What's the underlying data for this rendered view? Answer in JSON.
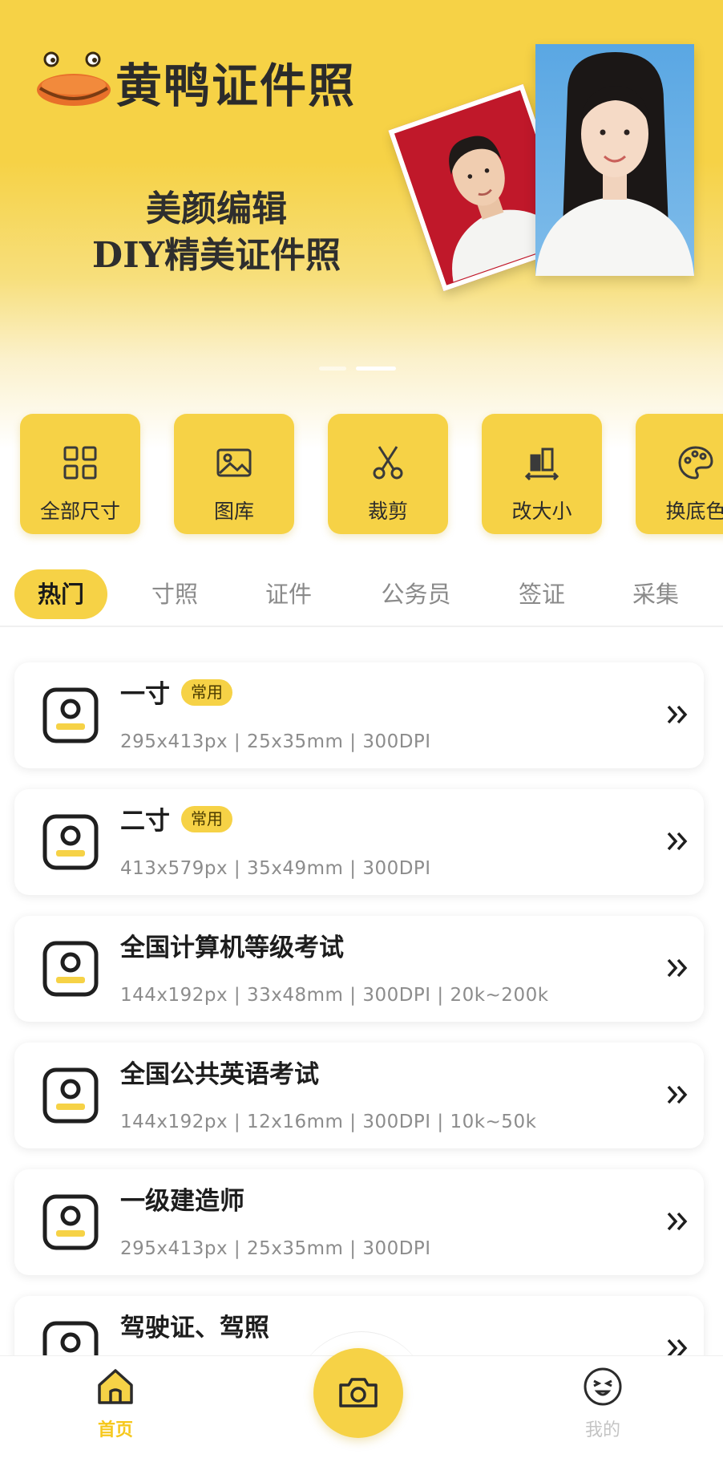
{
  "banner": {
    "app_name": "黄鸭证件照",
    "slogan_line1": "美颜编辑",
    "slogan_line2": "DIY精美证件照",
    "pagination": {
      "count": 2,
      "active_index": 1
    }
  },
  "tools": [
    {
      "label": "全部尺寸",
      "icon": "grid-icon"
    },
    {
      "label": "图库",
      "icon": "image-icon"
    },
    {
      "label": "裁剪",
      "icon": "scissors-icon"
    },
    {
      "label": "改大小",
      "icon": "resize-icon"
    },
    {
      "label": "换底色",
      "icon": "palette-icon"
    }
  ],
  "tabs": [
    {
      "label": "热门",
      "active": true
    },
    {
      "label": "寸照",
      "active": false
    },
    {
      "label": "证件",
      "active": false
    },
    {
      "label": "公务员",
      "active": false
    },
    {
      "label": "签证",
      "active": false
    },
    {
      "label": "采集",
      "active": false
    }
  ],
  "specs": [
    {
      "title": "一寸",
      "badge": "常用",
      "spec": "295x413px  |  25x35mm  |  300DPI"
    },
    {
      "title": "二寸",
      "badge": "常用",
      "spec": "413x579px  |  35x49mm  |  300DPI"
    },
    {
      "title": "全国计算机等级考试",
      "badge": "",
      "spec": "144x192px  |  33x48mm  |  300DPI  |  20k~200k"
    },
    {
      "title": "全国公共英语考试",
      "badge": "",
      "spec": "144x192px  |  12x16mm  |  300DPI  |  10k~50k"
    },
    {
      "title": "一级建造师",
      "badge": "",
      "spec": "295x413px  |  25x35mm  |  300DPI"
    },
    {
      "title": "驾驶证、驾照",
      "badge": "",
      "spec": ""
    }
  ],
  "bottom_nav": {
    "home_label": "首页",
    "mine_label": "我的",
    "camera_icon": "camera-icon"
  },
  "colors": {
    "brand_yellow": "#f6d246",
    "active_nav": "#f6c81d",
    "inactive_text": "#8a8a8a"
  }
}
